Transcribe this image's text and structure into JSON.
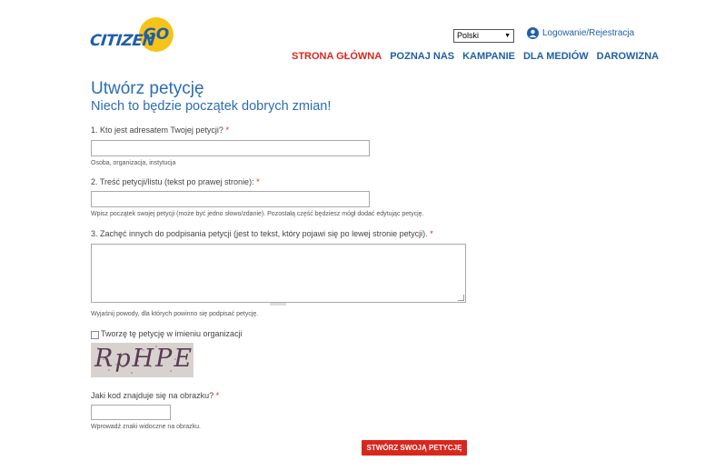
{
  "logo": {
    "part1": "CITIZEN",
    "part2": "GO"
  },
  "header": {
    "language": "Polski",
    "login_link": "Logowanie/Rejestracja",
    "nav": [
      {
        "label": "STRONA GŁÓWNA",
        "active": true
      },
      {
        "label": "POZNAJ NAS",
        "active": false
      },
      {
        "label": "KAMPANIE",
        "active": false
      },
      {
        "label": "DLA MEDIÓW",
        "active": false
      },
      {
        "label": "DAROWIZNA",
        "active": false
      }
    ]
  },
  "page": {
    "title": "Utwórz petycję",
    "subtitle": "Niech to będzie początek dobrych zmian!"
  },
  "form": {
    "q1": {
      "label": "1. Kto jest adresatem Twojej petycji?",
      "required": "*",
      "value": "",
      "hint": "Osoba, organizacja, instytucja"
    },
    "q2": {
      "label": "2. Treść petycji/listu (tekst po prawej stronie):",
      "required": "*",
      "value": "",
      "hint": "Wpisz początek swojej petycji (może być jedno słowo/zdanie). Pozostałą część będziesz mógł dodać edytując petycję."
    },
    "q3": {
      "label": "3. Zachęć innych do podpisania petycji (jest to tekst, który pojawi się po lewej stronie petycji).",
      "required": "*",
      "value": "",
      "hint": "Wyjaśnij powody, dla których powinno się podpisać petycję."
    },
    "organization_checkbox": {
      "label": "Tworzę tę petycję w imieniu organizacji",
      "checked": false
    },
    "captcha": {
      "image_text": "RpHPE",
      "label": "Jaki kod znajduje się na obrazku?",
      "required": "*",
      "value": "",
      "hint": "Wprowadź znaki widoczne na obrazku."
    },
    "submit_label": "STWÓRZ SWOJĄ PETYCJĘ"
  },
  "colors": {
    "brand_blue": "#1f5fa8",
    "accent_red": "#d9271e",
    "logo_yellow": "#f6c31a"
  }
}
